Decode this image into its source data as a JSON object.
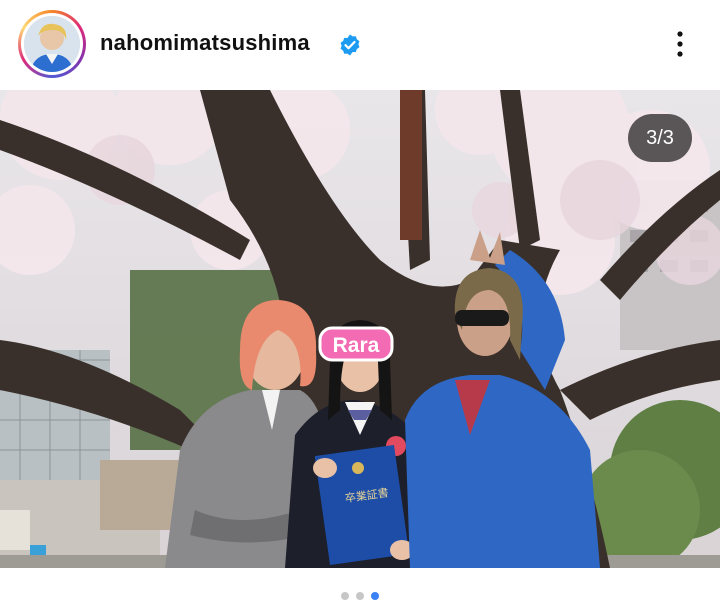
{
  "post": {
    "username": "nahomimatsushima",
    "verified": true,
    "photo": {
      "counter": "3/3",
      "sticker": "Rara",
      "diploma_text": "卒業証書"
    },
    "pagination": {
      "total": 3,
      "active_index": 3
    }
  },
  "icons": [
    "verified-badge-icon",
    "more-options-icon"
  ],
  "colors": {
    "verified": "#1d9bf0",
    "active_dot": "#3b82f6",
    "sticker_pink": "#f26bb3"
  }
}
